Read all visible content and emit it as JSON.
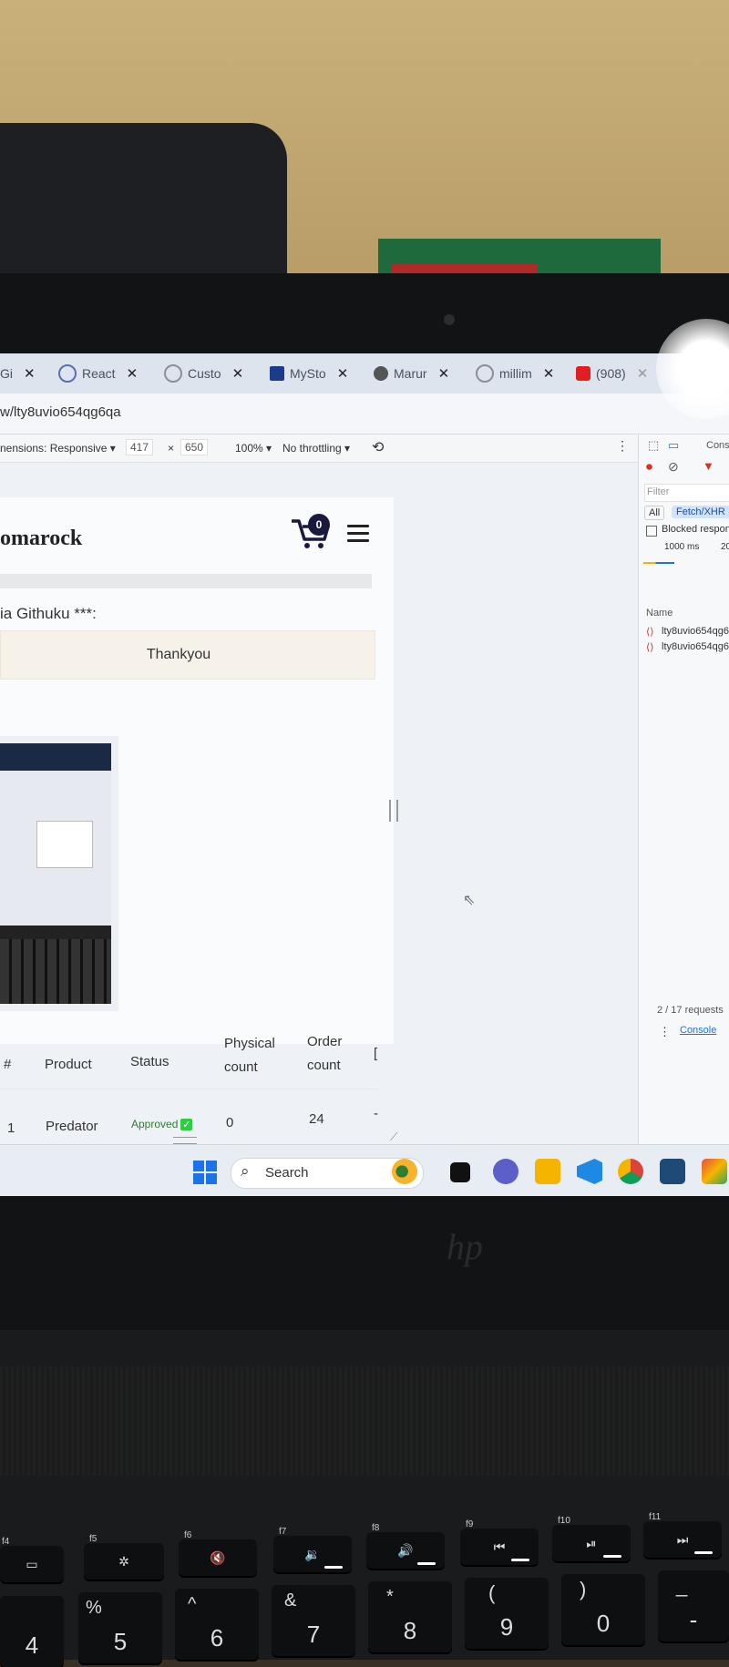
{
  "browser": {
    "tabs": [
      {
        "label": "Gi",
        "color": "#6b6b6b"
      },
      {
        "label": "React",
        "color": "#5a6fb0"
      },
      {
        "label": "Custo",
        "color": "#8a8f99"
      },
      {
        "label": "MySto",
        "color": "#1a3c8a"
      },
      {
        "label": "Marur",
        "color": "#555555"
      },
      {
        "label": "millim",
        "color": "#8a8f99"
      },
      {
        "label": "(908)",
        "color": "#e02020"
      }
    ],
    "address": "w/lty8uvio654qg6qa"
  },
  "devices_toolbar": {
    "dimensions_label": "nensions: Responsive ▾",
    "width": "417",
    "times": "×",
    "height": "650",
    "zoom": "100% ▾",
    "throttling": "No throttling ▾"
  },
  "page": {
    "brand": "omarock",
    "cart_count": "0",
    "greeting": "ia Githuku ***:",
    "thanks": "Thankyou",
    "table": {
      "headers": [
        "#",
        "Product",
        "Status",
        "Physical count",
        "Order count",
        "["
      ],
      "rows": [
        {
          "num": "1",
          "product": "Predator",
          "status": "Approved",
          "physical": "0",
          "order": "24",
          "extra": "-"
        }
      ]
    }
  },
  "devtools": {
    "tab_label": "Cons",
    "filter_placeholder": "Filter",
    "type_all": "All",
    "type_fetch": "Fetch/XHR",
    "blocked": "Blocked respon",
    "timeline_1000": "1000 ms",
    "timeline_2000": "20",
    "name_header": "Name",
    "requests": [
      {
        "name": "lty8uvio654qg6"
      },
      {
        "name": "lty8uvio654qg6"
      }
    ],
    "summary": "2 / 17 requests",
    "console_tab": "Console"
  },
  "taskbar": {
    "search_label": "Search",
    "icons": [
      "windows-start",
      "widgets",
      "task-view",
      "teams",
      "file-explorer",
      "vscode",
      "chrome",
      "terminal",
      "git"
    ]
  },
  "laptop": {
    "brand": "hp",
    "fkeys": [
      {
        "label": "f4",
        "glyph": "▭"
      },
      {
        "label": "f5",
        "glyph": "✲"
      },
      {
        "label": "f6",
        "glyph": "🔇"
      },
      {
        "label": "f7",
        "glyph": "🔉"
      },
      {
        "label": "f8",
        "glyph": "🔊"
      },
      {
        "label": "f9",
        "glyph": "⏮"
      },
      {
        "label": "f10",
        "glyph": "⏯"
      },
      {
        "label": "f11",
        "glyph": "⏭"
      }
    ],
    "numkeys": [
      {
        "top": "",
        "main": "4"
      },
      {
        "top": "%",
        "main": "5"
      },
      {
        "top": "^",
        "main": "6"
      },
      {
        "top": "&",
        "main": "7"
      },
      {
        "top": "*",
        "main": "8"
      },
      {
        "top": "(",
        "main": "9"
      },
      {
        "top": ")",
        "main": "0"
      },
      {
        "top": "_",
        "main": "-"
      }
    ]
  },
  "colors": {
    "accent_blue": "#1a73e8",
    "status_green": "#2ecc40",
    "badge_navy": "#1a1a3e"
  }
}
